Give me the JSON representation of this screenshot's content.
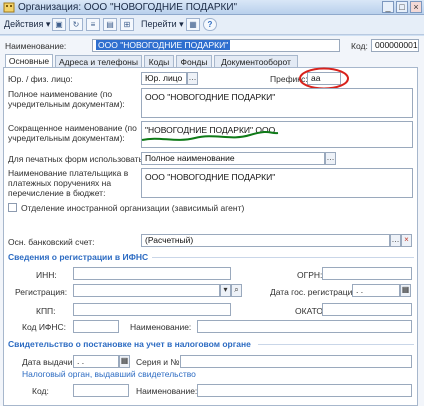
{
  "window": {
    "title": "Организация: ООО \"НОВОГОДНИЕ ПОДАРКИ\"",
    "min": "_",
    "max": "□",
    "close": "×"
  },
  "toolbar": {
    "actions": "Действия ▾",
    "goto": "Перейти ▾",
    "help": "?"
  },
  "header": {
    "name_label": "Наименование:",
    "name_value": "ООО \"НОВОГОДНИЕ ПОДАРКИ\"",
    "code_label": "Код:",
    "code_value": "000000001"
  },
  "tabs": [
    {
      "label": "Основные"
    },
    {
      "label": "Адреса и телефоны"
    },
    {
      "label": "Коды"
    },
    {
      "label": "Фонды"
    },
    {
      "label": "Документооборот"
    }
  ],
  "main": {
    "type_label": "Юр. / физ. лицо:",
    "type_value": "Юр. лицо",
    "prefix_label": "Префикс:",
    "prefix_value": "аа",
    "full_name_label": "Полное наименование (по учредительным документам):",
    "full_name_value": "ООО \"НОВОГОДНИЕ ПОДАРКИ\"",
    "short_name_label": "Сокращенное наименование (по учредительным документам):",
    "short_name_value": "\"НОВОГОДНИЕ ПОДАРКИ\" ООО",
    "print_label": "Для печатных форм использовать:",
    "print_value": "Полное наименование",
    "payer_label": "Наименование плательщика в платежных поручениях на перечисление в бюджет:",
    "payer_value": "ООО \"НОВОГОДНИЕ ПОДАРКИ\"",
    "foreign_label": "Отделение иностранной организации (зависимый агент)",
    "bank_label": "Осн. банковский счет:",
    "bank_value": "(Расчетный)"
  },
  "ifns": {
    "title": "Сведения о регистрации в ИФНС",
    "inn_label": "ИНН:",
    "ogrn_label": "ОГРН:",
    "reg_label": "Регистрация:",
    "reg_date_label": "Дата гос. регистрации:",
    "reg_date_value": ". .",
    "kpp_label": "КПП:",
    "okato_label": "ОКАТО:",
    "ifns_code_label": "Код ИФНС:",
    "ifns_name_label": "Наименование:"
  },
  "certificate": {
    "title": "Свидетельство о постановке на учет в налоговом органе",
    "issue_date_label": "Дата выдачи:",
    "issue_date_value": ". .",
    "series_label": "Серия и №:",
    "issuer_label": "Налоговый орган, выдавший свидетельство",
    "code_label": "Код:",
    "name_label": "Наименование:"
  },
  "colors": {
    "annotation_red": "#d8221c",
    "annotation_green": "#0f7a18",
    "selection": "#2f6fcf",
    "section": "#2c6bc2"
  }
}
